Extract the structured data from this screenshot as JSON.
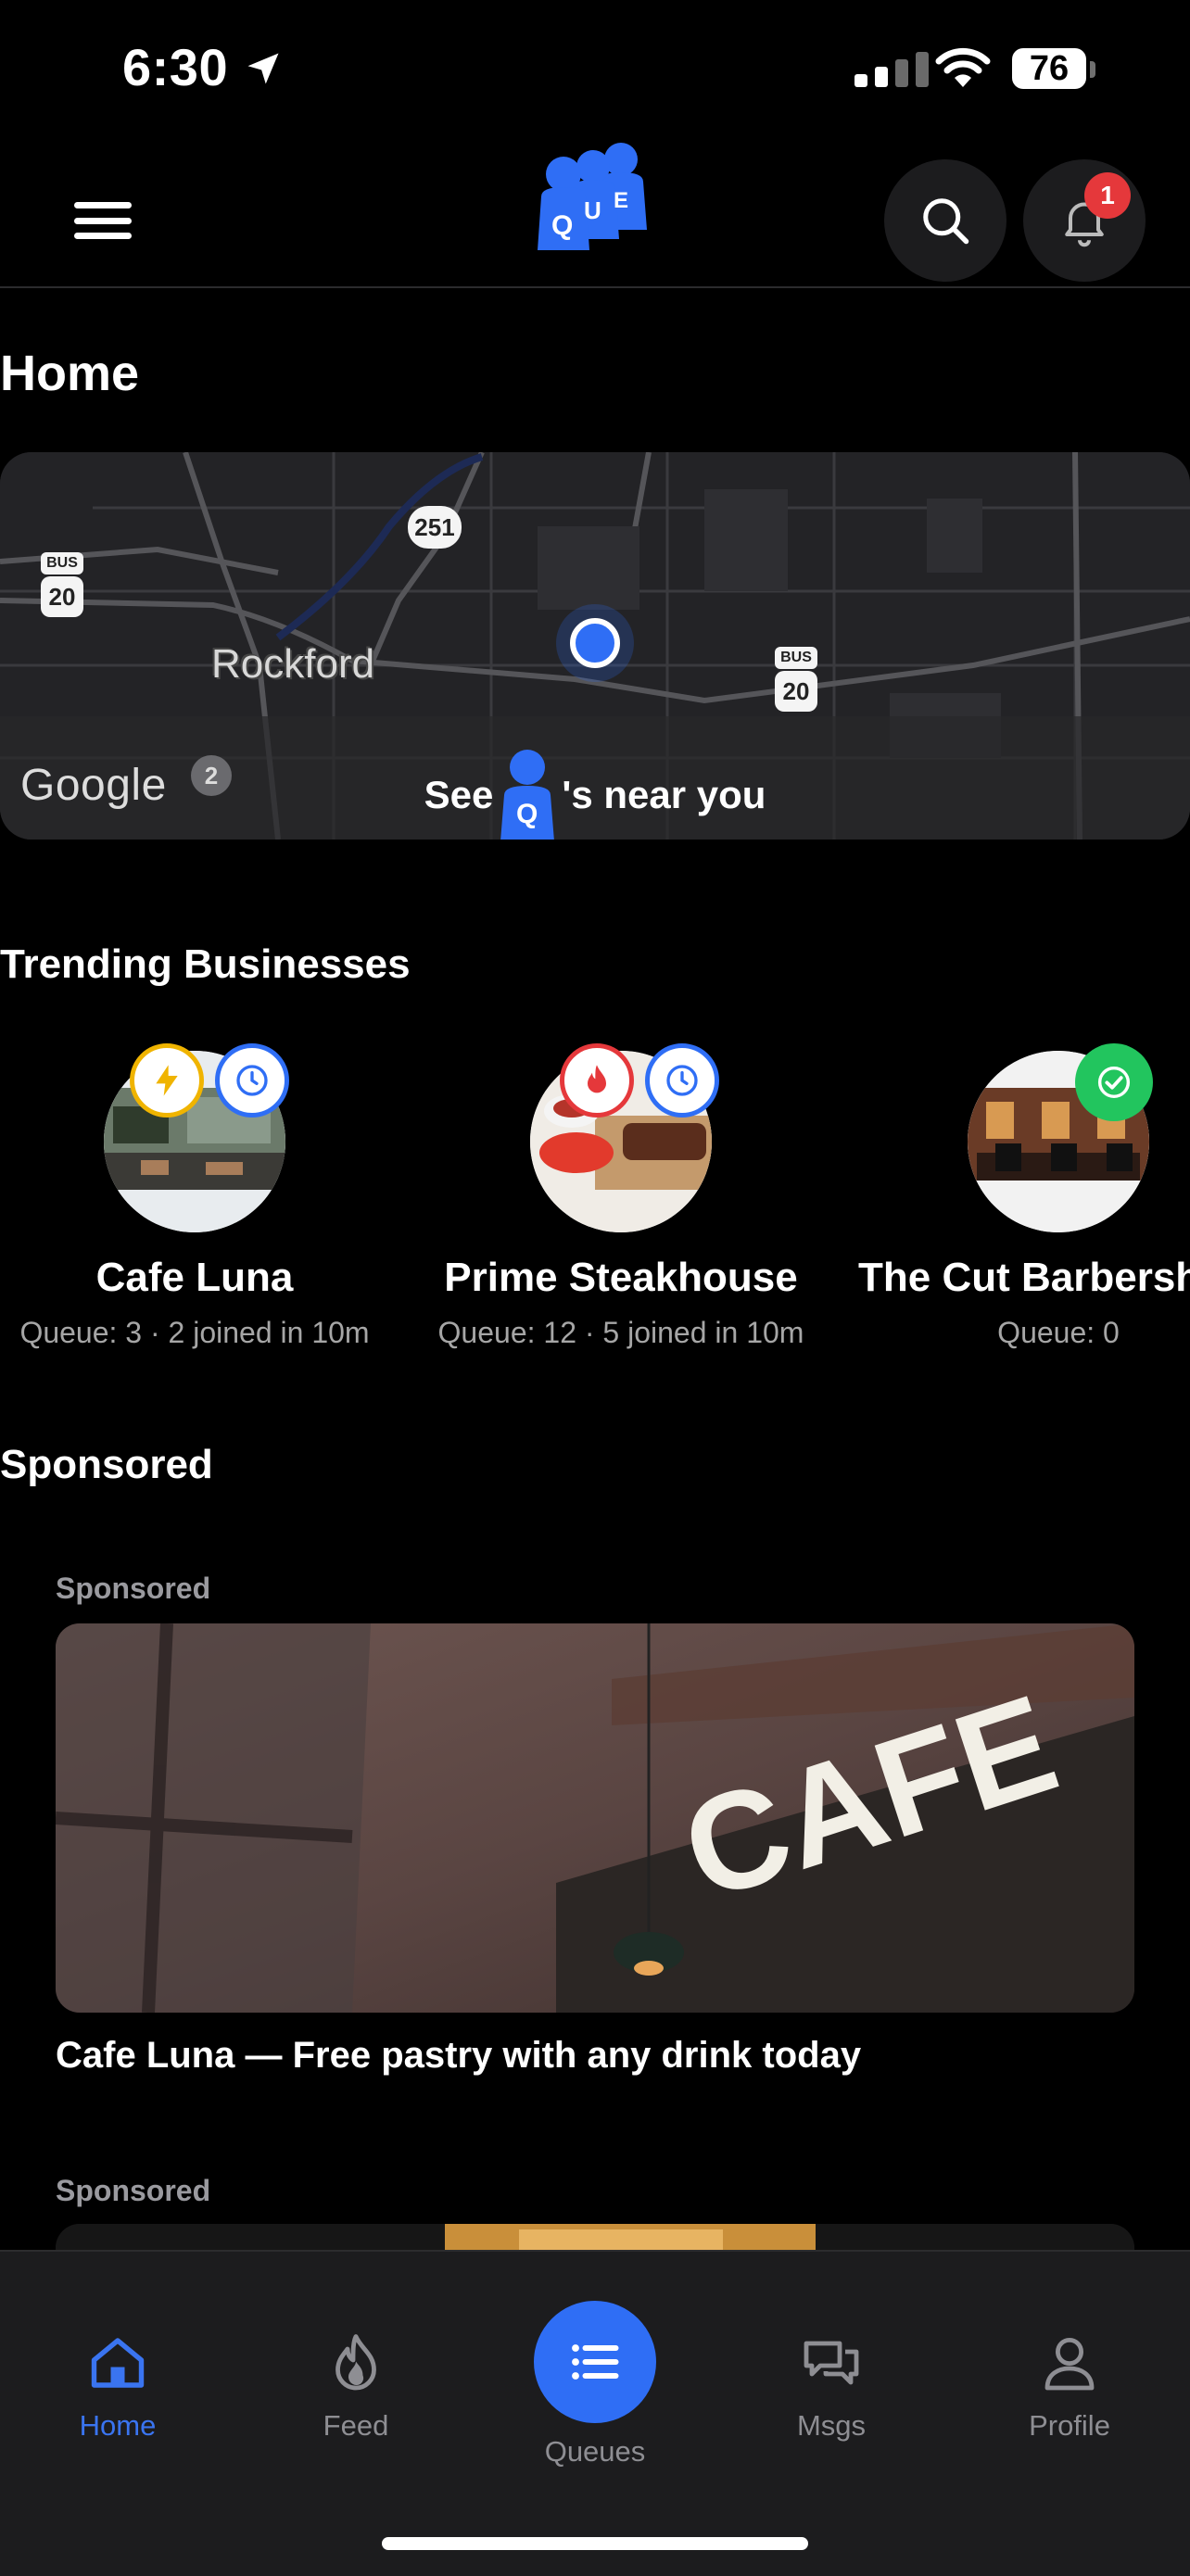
{
  "status_bar": {
    "time": "6:30",
    "battery": "76",
    "location_icon": "location-arrow-icon",
    "wifi_icon": "wifi-icon",
    "signal_icon": "cellular-signal-icon"
  },
  "header": {
    "logo_letters": [
      "Q",
      "U",
      "E"
    ],
    "menu_icon": "hamburger-menu-icon",
    "search_icon": "search-icon",
    "notifications_icon": "bell-icon",
    "notification_count": "1"
  },
  "page": {
    "title": "Home"
  },
  "map": {
    "city_label": "Rockford",
    "route_labels": [
      "251",
      "20",
      "20",
      "2"
    ],
    "bus_label": "BUS",
    "attribution": "Google",
    "cta_before": "See",
    "cta_icon_letter": "Q",
    "cta_after": "'s near you"
  },
  "trending": {
    "title": "Trending Businesses",
    "items": [
      {
        "name": "Cafe Luna",
        "meta": "Queue: 3 · 2 joined in 10m",
        "badges": [
          "lightning-icon",
          "clock-icon"
        ]
      },
      {
        "name": "Prime Steakhouse",
        "meta": "Queue: 12 · 5 joined in 10m",
        "badges": [
          "flame-icon",
          "clock-icon"
        ]
      },
      {
        "name": "The Cut Barbersh",
        "meta": "Queue: 0",
        "badges": [
          "check-icon"
        ]
      }
    ]
  },
  "sponsored": {
    "title": "Sponsored",
    "items": [
      {
        "label": "Sponsored",
        "image_text": "CAFE",
        "caption": "Cafe Luna — Free pastry with any drink today"
      },
      {
        "label": "Sponsored"
      }
    ]
  },
  "tabbar": {
    "tabs": [
      {
        "label": "Home",
        "icon": "home-icon",
        "active": true
      },
      {
        "label": "Feed",
        "icon": "flame-icon",
        "active": false
      },
      {
        "label": "Queues",
        "icon": "list-icon",
        "active": false
      },
      {
        "label": "Msgs",
        "icon": "chat-bubbles-icon",
        "active": false
      },
      {
        "label": "Profile",
        "icon": "person-icon",
        "active": false
      }
    ]
  },
  "colors": {
    "accent": "#2f6ef5",
    "badge_red": "#e5383b",
    "badge_yellow": "#f0b400",
    "badge_green": "#22c55e",
    "background": "#000000"
  }
}
